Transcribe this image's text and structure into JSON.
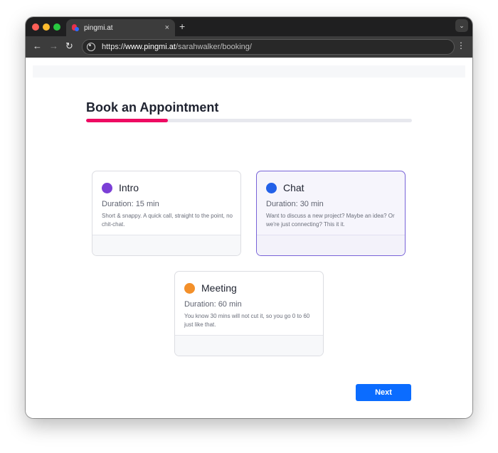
{
  "browser": {
    "tab_title": "pingmi.at",
    "tab_close": "×",
    "new_tab": "+",
    "menu_icon": "⌄",
    "back_icon": "←",
    "forward_icon": "→",
    "reload_icon": "↻",
    "url_scheme": "https://",
    "url_host": "www.pingmi.at",
    "url_path": "/sarahwalker/booking/",
    "kebab_icon": "⋮"
  },
  "page": {
    "title": "Book an Appointment",
    "progress": 0.25,
    "accent_color": "#ee0a62",
    "next_label": "Next",
    "next_color": "#0b6cff"
  },
  "options": [
    {
      "name": "Intro",
      "duration": "Duration: 15 min",
      "description": "Short & snappy. A quick call, straight to the point, no chit-chat.",
      "color": "#7b3fd6",
      "selected": false
    },
    {
      "name": "Chat",
      "duration": "Duration: 30 min",
      "description": "Want to discuss a new project? Maybe an idea? Or we're just connecting? This it it.",
      "color": "#2361e8",
      "selected": true
    },
    {
      "name": "Meeting",
      "duration": "Duration: 60 min",
      "description": "You know 30 mins will not cut it, so you go 0 to 60 just like that.",
      "color": "#f3902a",
      "selected": false
    }
  ]
}
